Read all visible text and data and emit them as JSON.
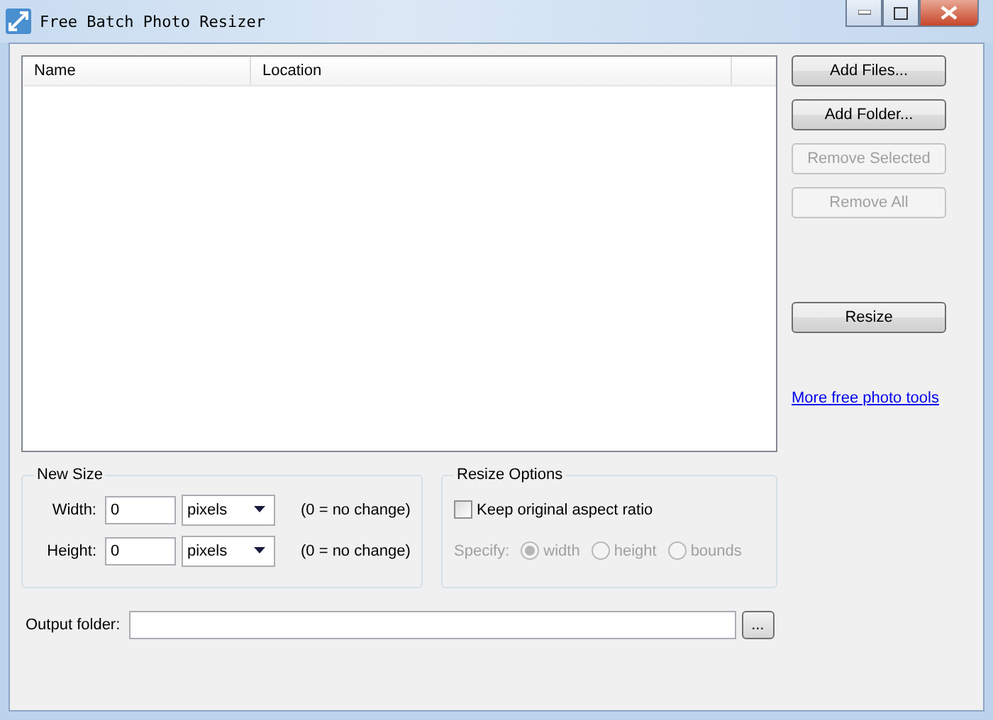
{
  "window": {
    "title": "Free Batch Photo Resizer"
  },
  "file_list": {
    "columns": [
      "Name",
      "Location"
    ]
  },
  "file_buttons": [
    {
      "label": "Add Files...",
      "disabled": false
    },
    {
      "label": "Add Folder...",
      "disabled": false
    },
    {
      "label": "Remove Selected",
      "disabled": true
    },
    {
      "label": "Remove All",
      "disabled": true
    }
  ],
  "resize_button": {
    "label": "Resize",
    "disabled": false
  },
  "link": "More free photo tools",
  "new_size": {
    "title": "New Size",
    "rows": [
      {
        "label": "Width:",
        "value": "0",
        "unit": "pixels",
        "hint": "(0 = no change)"
      },
      {
        "label": "Height:",
        "value": "0",
        "unit": "pixels",
        "hint": "(0 = no change)"
      }
    ]
  },
  "resize_options": {
    "title": "Resize Options",
    "keep_aspect": {
      "label": "Keep original aspect ratio",
      "checked": false
    },
    "specify": {
      "label": "Specify:",
      "disabled": true,
      "options": [
        {
          "label": "width",
          "selected": true
        },
        {
          "label": "height",
          "selected": false
        },
        {
          "label": "bounds",
          "selected": false
        }
      ]
    }
  },
  "output_folder": {
    "label": "Output folder:",
    "browse": "..."
  }
}
